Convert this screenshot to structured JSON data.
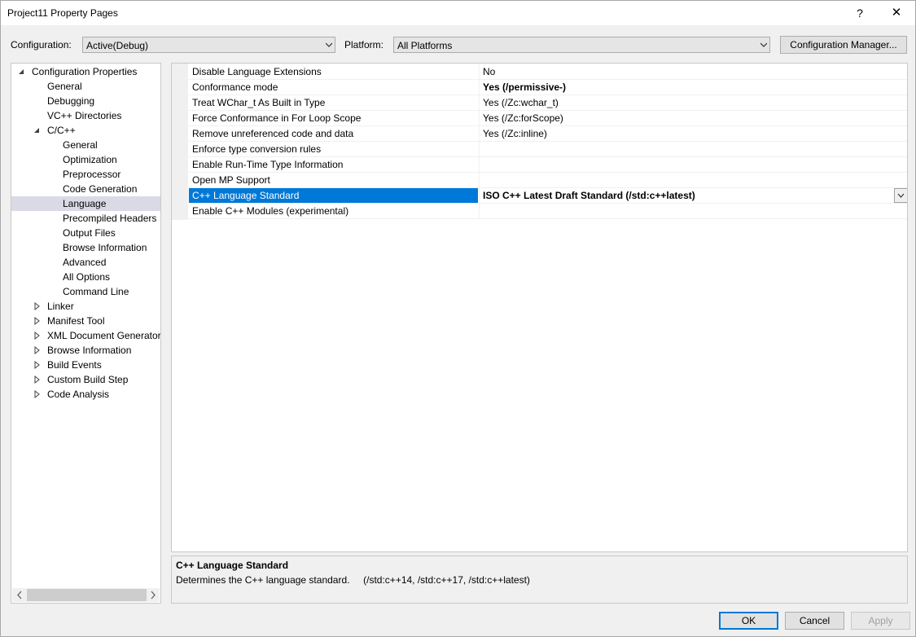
{
  "window": {
    "title": "Project11 Property Pages",
    "help_glyph": "?",
    "close_glyph": "✕"
  },
  "toolbar": {
    "configuration_label": "Configuration:",
    "configuration_value": "Active(Debug)",
    "platform_label": "Platform:",
    "platform_value": "All Platforms",
    "config_manager_label": "Configuration Manager..."
  },
  "tree": {
    "items": [
      {
        "label": "Configuration Properties",
        "level": 0,
        "expander": "expanded"
      },
      {
        "label": "General",
        "level": 1
      },
      {
        "label": "Debugging",
        "level": 1
      },
      {
        "label": "VC++ Directories",
        "level": 1
      },
      {
        "label": "C/C++",
        "level": 1,
        "expander": "expanded"
      },
      {
        "label": "General",
        "level": 2
      },
      {
        "label": "Optimization",
        "level": 2
      },
      {
        "label": "Preprocessor",
        "level": 2
      },
      {
        "label": "Code Generation",
        "level": 2
      },
      {
        "label": "Language",
        "level": 2,
        "selected": true
      },
      {
        "label": "Precompiled Headers",
        "level": 2
      },
      {
        "label": "Output Files",
        "level": 2
      },
      {
        "label": "Browse Information",
        "level": 2
      },
      {
        "label": "Advanced",
        "level": 2
      },
      {
        "label": "All Options",
        "level": 2
      },
      {
        "label": "Command Line",
        "level": 2
      },
      {
        "label": "Linker",
        "level": 1,
        "expander": "collapsed"
      },
      {
        "label": "Manifest Tool",
        "level": 1,
        "expander": "collapsed"
      },
      {
        "label": "XML Document Generator",
        "level": 1,
        "expander": "collapsed"
      },
      {
        "label": "Browse Information",
        "level": 1,
        "expander": "collapsed"
      },
      {
        "label": "Build Events",
        "level": 1,
        "expander": "collapsed"
      },
      {
        "label": "Custom Build Step",
        "level": 1,
        "expander": "collapsed"
      },
      {
        "label": "Code Analysis",
        "level": 1,
        "expander": "collapsed"
      }
    ]
  },
  "properties": [
    {
      "name": "Disable Language Extensions",
      "value": "No"
    },
    {
      "name": "Conformance mode",
      "value": "Yes (/permissive-)",
      "bold": true
    },
    {
      "name": "Treat WChar_t As Built in Type",
      "value": "Yes (/Zc:wchar_t)"
    },
    {
      "name": "Force Conformance in For Loop Scope",
      "value": "Yes (/Zc:forScope)"
    },
    {
      "name": "Remove unreferenced code and data",
      "value": "Yes (/Zc:inline)"
    },
    {
      "name": "Enforce type conversion rules",
      "value": ""
    },
    {
      "name": "Enable Run-Time Type Information",
      "value": ""
    },
    {
      "name": "Open MP Support",
      "value": ""
    },
    {
      "name": "C++ Language Standard",
      "value": "ISO C++ Latest Draft Standard (/std:c++latest)",
      "bold": true,
      "selected": true
    },
    {
      "name": "Enable C++ Modules (experimental)",
      "value": ""
    }
  ],
  "description": {
    "title": "C++ Language Standard",
    "text": "Determines the C++ language standard.     (/std:c++14, /std:c++17, /std:c++latest)"
  },
  "buttons": {
    "ok": "OK",
    "cancel": "Cancel",
    "apply": "Apply"
  },
  "colors": {
    "selection": "#0078d7",
    "tree_selection": "#dadae6",
    "window_bg": "#f0f0f0"
  }
}
